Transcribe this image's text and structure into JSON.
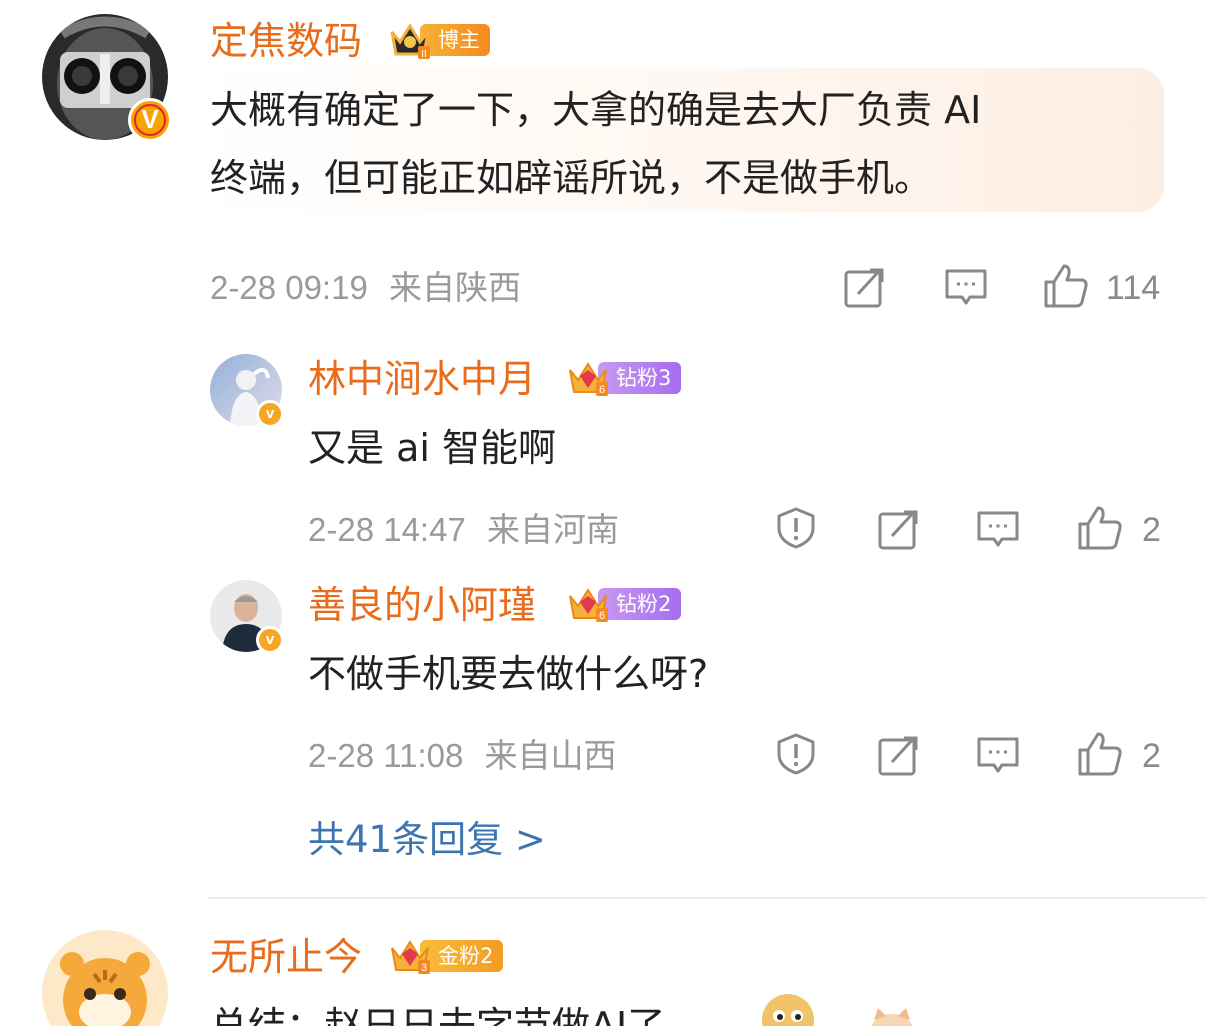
{
  "comments": [
    {
      "name": "定焦数码",
      "badge": "博主",
      "verified_mark": "V",
      "text_line1": "大概有确定了一下，大拿的确是去大厂负责 AI",
      "text_line2": "终端，但可能正如辟谣所说，不是做手机。",
      "time": "2-28 09:19",
      "location": "来自陕西",
      "like_count": "114"
    }
  ],
  "replies": [
    {
      "name": "林中涧水中月",
      "badge": "钻粉3",
      "crown_level": "6",
      "text": "又是 ai 智能啊",
      "time": "2-28 14:47",
      "location": "来自河南",
      "like_count": "2"
    },
    {
      "name": "善良的小阿瑾",
      "badge": "钻粉2",
      "crown_level": "6",
      "text": "不做手机要去做什么呀?",
      "time": "2-28 11:08",
      "location": "来自山西",
      "like_count": "2"
    }
  ],
  "more_replies": "共41条回复 >",
  "next_comment": {
    "name": "无所止今",
    "badge": "金粉2",
    "crown_level": "3",
    "text_partial": "总结：赵日日去字节做AI了"
  },
  "colors": {
    "name_orange": "#e86c1c",
    "link_blue": "#3e74b0",
    "meta_gray": "#9a9a9a"
  },
  "icons": [
    "repost-icon",
    "comment-icon",
    "like-icon",
    "report-icon"
  ]
}
